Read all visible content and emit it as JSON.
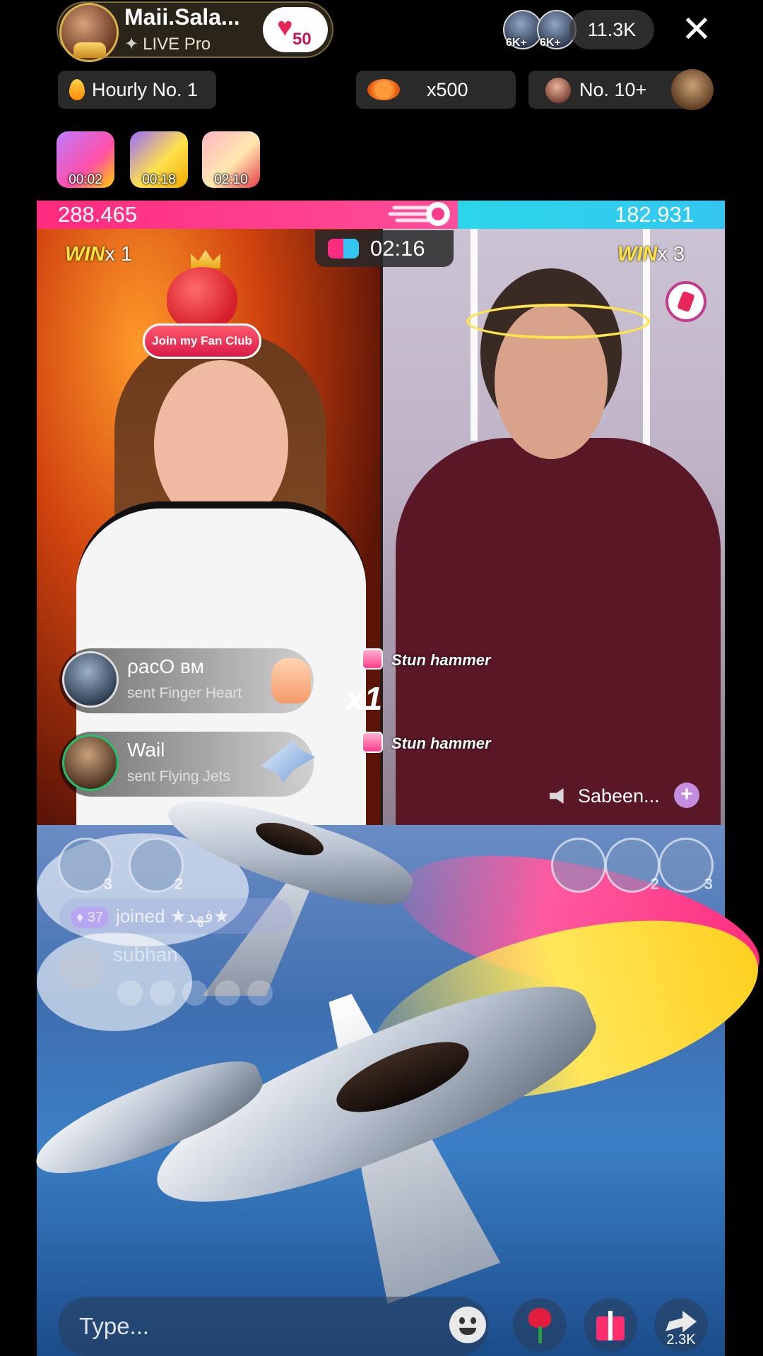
{
  "host": {
    "name": "Maii.Sala...",
    "subtitle": "LIVE Pro",
    "fan_level": "50"
  },
  "viewers": {
    "badges": [
      "6K+",
      "6K+"
    ],
    "count": "11.3K"
  },
  "chips": {
    "hourly": "Hourly No. 1",
    "multiplier": "x500",
    "rank": "No. 10+"
  },
  "treasures": [
    {
      "timer": "00:02"
    },
    {
      "timer": "00:18"
    },
    {
      "timer": "02:10"
    }
  ],
  "battle": {
    "left_score": "288.465",
    "right_score": "182.931",
    "left_share": 0.612,
    "timer": "02:16",
    "left_win_label": "WIN",
    "left_win_count": "x 1",
    "right_win_label": "WIN",
    "right_win_count": "x 3",
    "colors": {
      "left": "#ff2b7f",
      "right": "#34c6f0"
    }
  },
  "fan_club": {
    "label": "Join my Fan Club"
  },
  "gifts": [
    {
      "user": "ρacO вм",
      "action": "sent Finger Heart"
    },
    {
      "user": "Wail",
      "action": "sent Flying Jets"
    }
  ],
  "combo": "x1",
  "stun": [
    "Stun hammer",
    "Stun hammer"
  ],
  "guest": {
    "name": "Sabeen..."
  },
  "top_viewers_left": [
    {
      "rank": "3"
    },
    {
      "rank": "2"
    }
  ],
  "top_viewers_right": [
    {
      "rank": ""
    },
    {
      "rank": "2"
    },
    {
      "rank": "3"
    }
  ],
  "chat": {
    "joined_level": "37",
    "joined_text": "joined ★فهد★",
    "comment_user": "subhan"
  },
  "bottom": {
    "placeholder": "Type...",
    "share_count": "2.3K"
  }
}
